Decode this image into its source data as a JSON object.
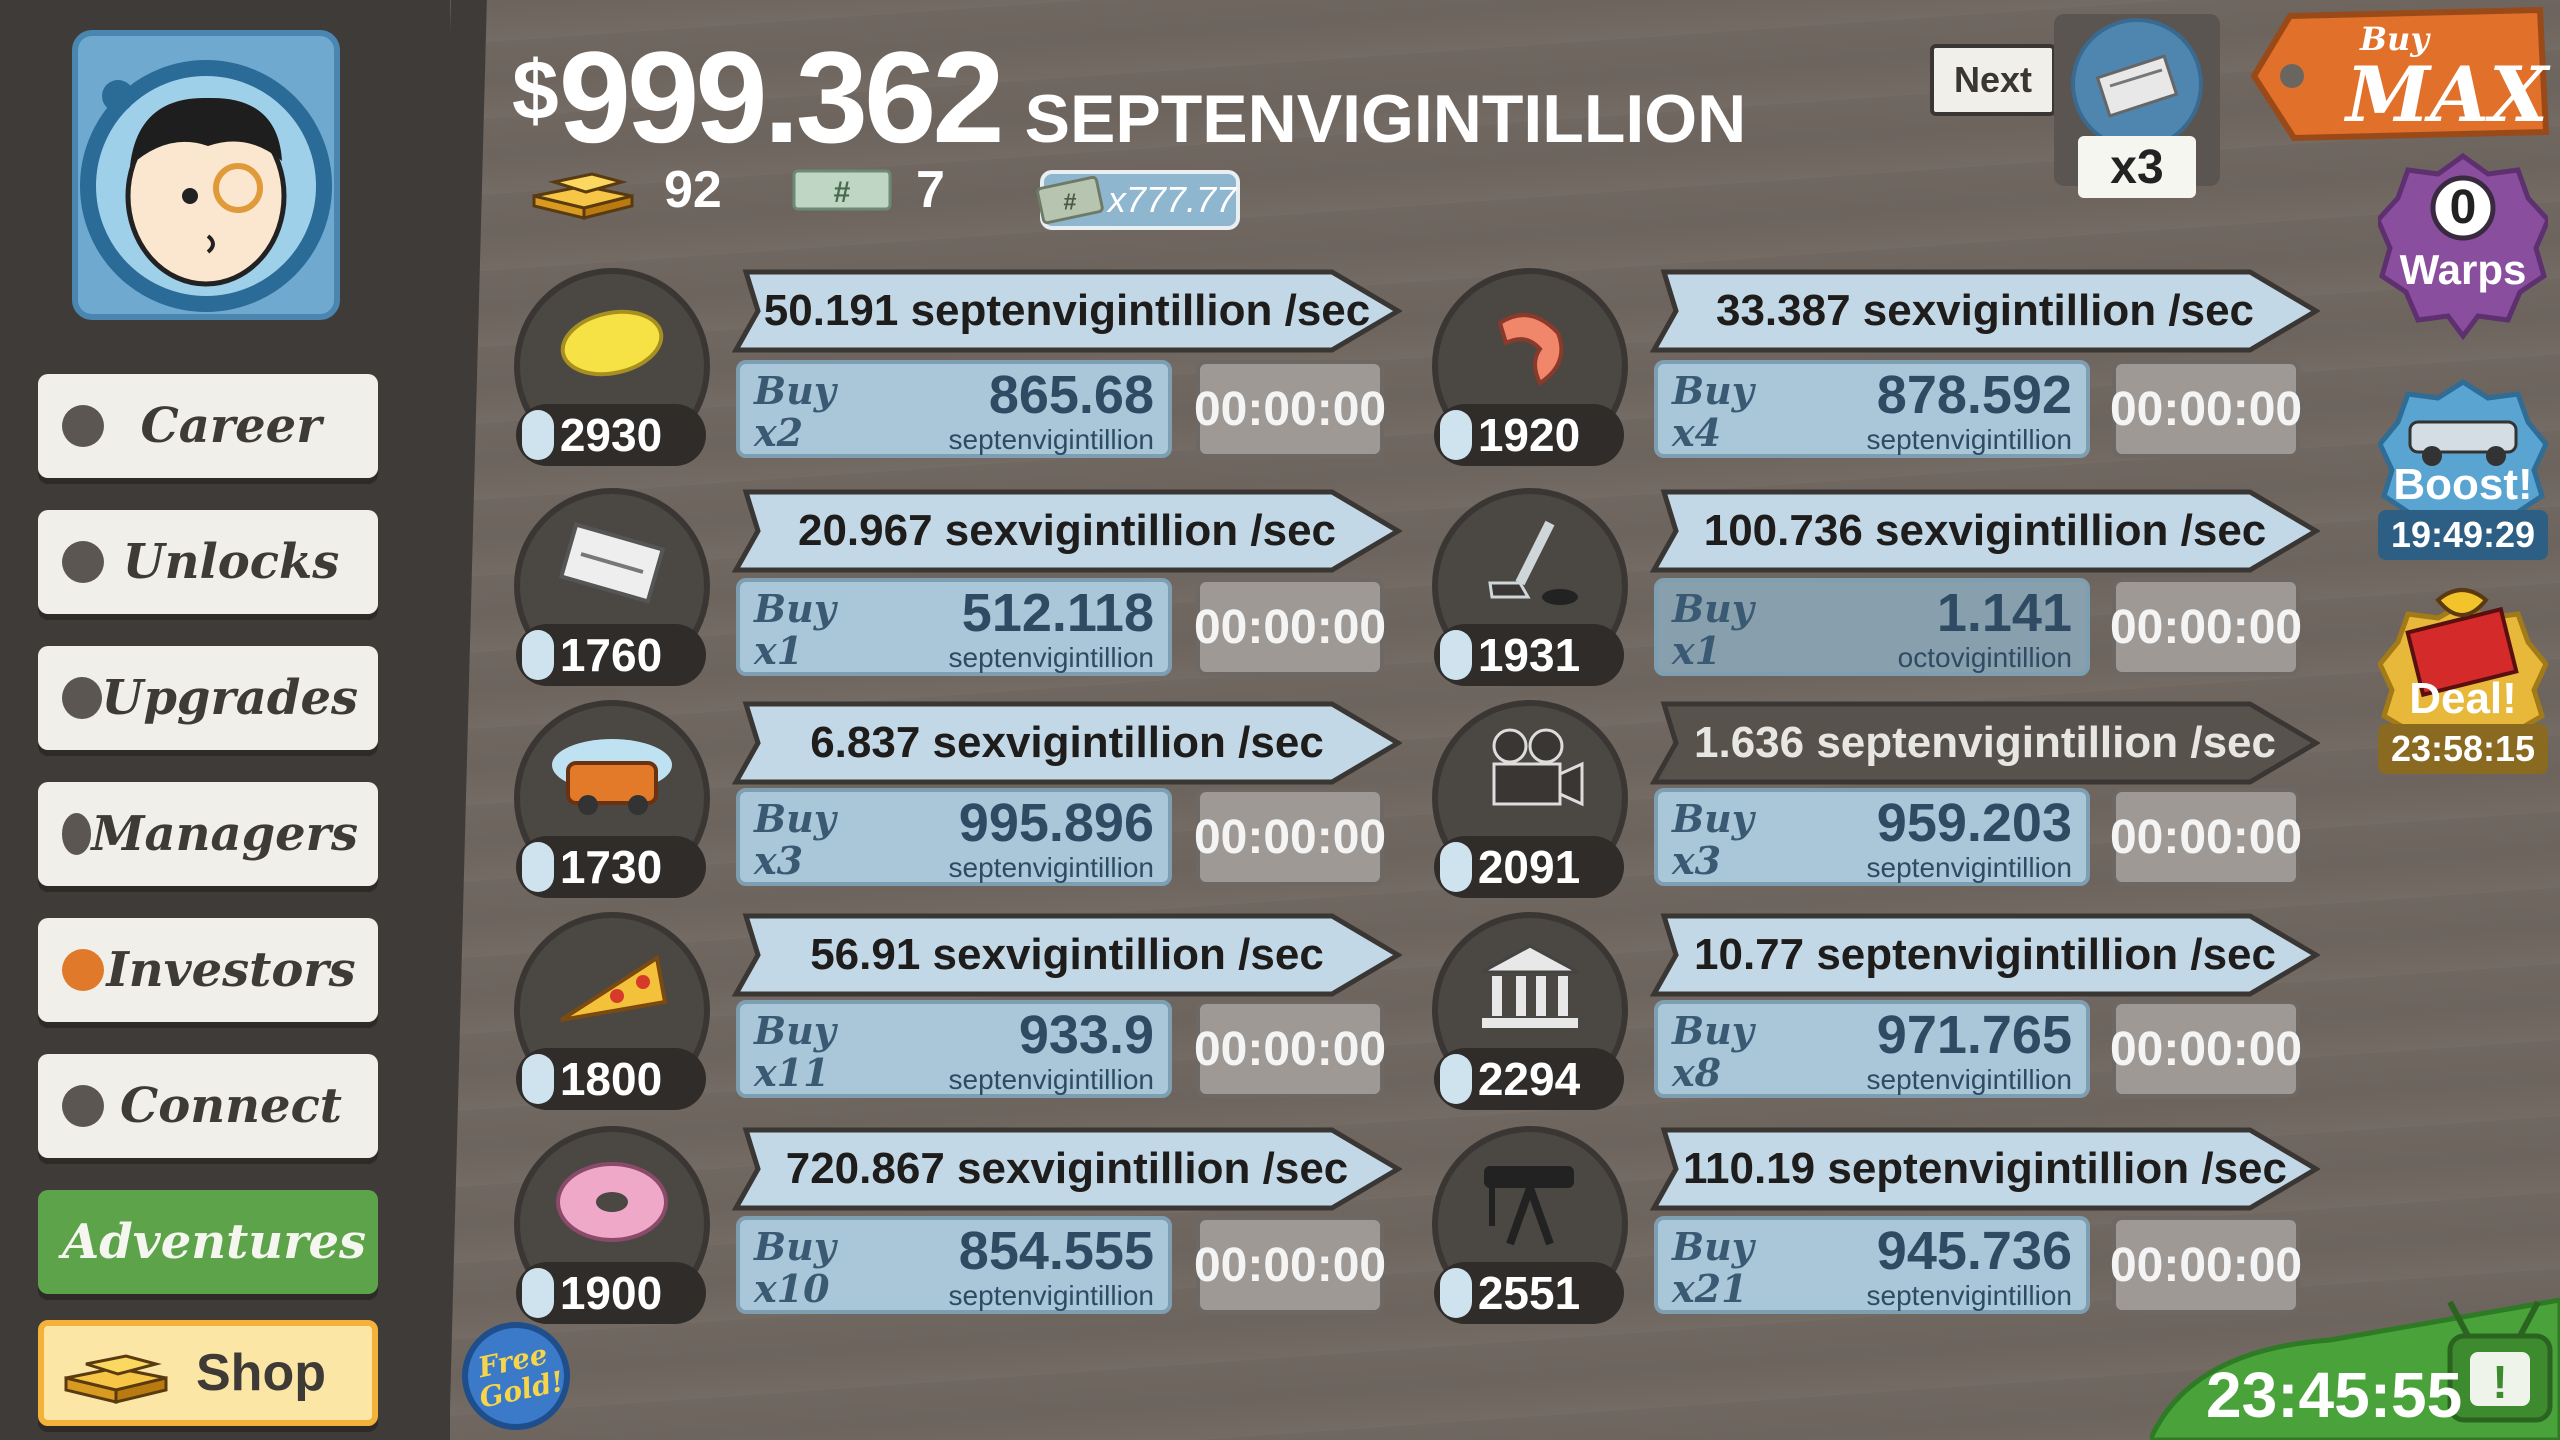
{
  "header": {
    "currency_symbol": "$",
    "amount": "999.362",
    "unit": "SEPTENVIGINTILLION",
    "gold": "92",
    "megabucks": "7",
    "angel_multiplier": "x777.77"
  },
  "nav": [
    {
      "label": "Career"
    },
    {
      "label": "Unlocks"
    },
    {
      "label": "Upgrades"
    },
    {
      "label": "Managers"
    },
    {
      "label": "Investors"
    },
    {
      "label": "Connect"
    },
    {
      "label": "Adventures"
    },
    {
      "label": "Shop"
    }
  ],
  "free_gold_label": "Free Gold!",
  "next_label": "Next",
  "multiplier": "x3",
  "buy_max": {
    "line1": "Buy",
    "line2": "MAX"
  },
  "warps": {
    "count": "0",
    "label": "Warps"
  },
  "boost": {
    "label": "Boost!",
    "time": "19:49:29"
  },
  "deal": {
    "label": "Deal!",
    "time": "23:58:15"
  },
  "bottom_timer": "23:45:55",
  "businesses_left": [
    {
      "icon": "lemon-icon",
      "count": "2930",
      "rate": "50.191 septenvigintillion /sec",
      "buy_label": "Buy",
      "qty": "x2",
      "cost": "865.68",
      "cost_unit": "septenvigintillion",
      "timer": "00:00:00"
    },
    {
      "icon": "newspaper-icon",
      "count": "1760",
      "rate": "20.967 sexvigintillion /sec",
      "buy_label": "Buy",
      "qty": "x1",
      "cost": "512.118",
      "cost_unit": "septenvigintillion",
      "timer": "00:00:00"
    },
    {
      "icon": "car-wash-icon",
      "count": "1730",
      "rate": "6.837 sexvigintillion /sec",
      "buy_label": "Buy",
      "qty": "x3",
      "cost": "995.896",
      "cost_unit": "septenvigintillion",
      "timer": "00:00:00"
    },
    {
      "icon": "pizza-icon",
      "count": "1800",
      "rate": "56.91 sexvigintillion /sec",
      "buy_label": "Buy",
      "qty": "x11",
      "cost": "933.9",
      "cost_unit": "septenvigintillion",
      "timer": "00:00:00"
    },
    {
      "icon": "donut-icon",
      "count": "1900",
      "rate": "720.867 sexvigintillion /sec",
      "buy_label": "Buy",
      "qty": "x10",
      "cost": "854.555",
      "cost_unit": "septenvigintillion",
      "timer": "00:00:00"
    }
  ],
  "businesses_right": [
    {
      "icon": "shrimp-icon",
      "count": "1920",
      "rate": "33.387 sexvigintillion /sec",
      "buy_label": "Buy",
      "qty": "x4",
      "cost": "878.592",
      "cost_unit": "septenvigintillion",
      "timer": "00:00:00",
      "dim": false
    },
    {
      "icon": "hockey-icon",
      "count": "1931",
      "rate": "100.736 sexvigintillion /sec",
      "buy_label": "Buy",
      "qty": "x1",
      "cost": "1.141",
      "cost_unit": "octovigintillion",
      "timer": "00:00:00",
      "dim": true
    },
    {
      "icon": "movie-camera-icon",
      "count": "2091",
      "rate": "1.636 septenvigintillion /sec",
      "buy_label": "Buy",
      "qty": "x3",
      "cost": "959.203",
      "cost_unit": "septenvigintillion",
      "timer": "00:00:00",
      "dim": false
    },
    {
      "icon": "bank-icon",
      "count": "2294",
      "rate": "10.77 septenvigintillion /sec",
      "buy_label": "Buy",
      "qty": "x8",
      "cost": "971.765",
      "cost_unit": "septenvigintillion",
      "timer": "00:00:00",
      "dim": false
    },
    {
      "icon": "oil-rig-icon",
      "count": "2551",
      "rate": "110.19 septenvigintillion /sec",
      "buy_label": "Buy",
      "qty": "x21",
      "cost": "945.736",
      "cost_unit": "septenvigintillion",
      "timer": "00:00:00",
      "dim": false
    }
  ]
}
